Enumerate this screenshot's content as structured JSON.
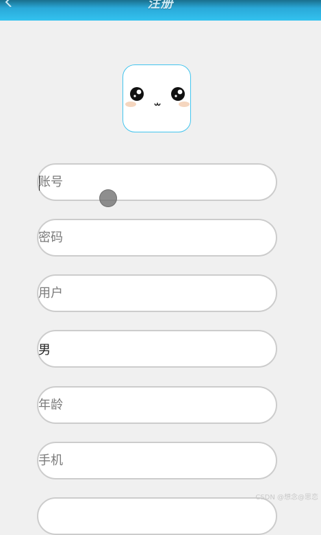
{
  "header": {
    "title": "注册",
    "back_icon": "chevron-left-icon",
    "colors": {
      "bar_top": "#1a6f8d",
      "bar_bottom": "#33c2ef"
    }
  },
  "avatar": {
    "icon": "kawaii-face-icon",
    "border_color": "#40c4ee"
  },
  "form": {
    "account_placeholder": "账号",
    "password_placeholder": "密码",
    "username_placeholder": "用户",
    "gender_value": "男",
    "age_placeholder": "年龄",
    "phone_placeholder": "手机"
  },
  "watermark": "CSDN @想念@思恋"
}
